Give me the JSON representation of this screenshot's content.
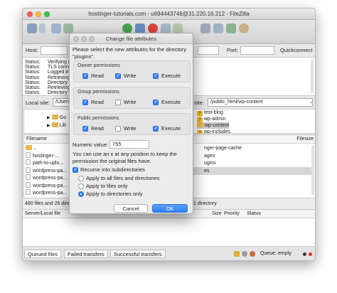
{
  "window": {
    "title": "hostinger-tutorials.com - u694443746@31.220.16.212 - FileZilla"
  },
  "quickconnect": {
    "host_label": "Host:",
    "port_label": "Port:",
    "button_label": "Quickconnect"
  },
  "log": {
    "lines": [
      {
        "label": "Status:",
        "text": "Verifying c"
      },
      {
        "label": "Status:",
        "text": "TLS connec"
      },
      {
        "label": "Status:",
        "text": "Logged in"
      },
      {
        "label": "Status:",
        "text": "Retrieving"
      },
      {
        "label": "Status:",
        "text": "Directory l"
      },
      {
        "label": "Status:",
        "text": "Retrieving"
      },
      {
        "label": "Status:",
        "text": "Directory l"
      }
    ]
  },
  "local": {
    "label": "Local site:",
    "path": "/Users",
    "tree": [
      "Go",
      "Lib"
    ],
    "filename_header": "Filename",
    "files": [
      "..",
      "hostinger-...",
      "path-to-uplo...",
      "wordpress-pa...",
      "wordpress-pa...",
      "wordpress-pa...",
      "wordpress-pa..."
    ],
    "status": "480 files and 26 dire"
  },
  "remote": {
    "label": "site:",
    "path": "/public_html/wp-content",
    "tree": [
      "test-blog",
      "wp-admin",
      "wp-content",
      "wp-includes"
    ],
    "filesize_header": "Filesize",
    "files": [
      "nger-page-cache",
      "ages",
      "ugins",
      "es",
      "",
      "",
      ""
    ],
    "status": "1 directory."
  },
  "queue": {
    "col_server": "Server/Local file",
    "col_size": "Size",
    "col_priority": "Priority",
    "col_status": "Status"
  },
  "tabs": [
    {
      "label": "Queued files",
      "active": true
    },
    {
      "label": "Failed transfers",
      "active": false
    },
    {
      "label": "Successful transfers",
      "active": false
    }
  ],
  "statusbar": {
    "queue": "Queue: empty"
  },
  "dialog": {
    "title": "Change file attributes",
    "intro": "Please select the new attributes for the directory \"plugins\".",
    "groups": [
      {
        "label": "Owner permissions",
        "read": true,
        "write": true,
        "execute": true
      },
      {
        "label": "Group permissions",
        "read": true,
        "write": false,
        "execute": true
      },
      {
        "label": "Public permissions",
        "read": true,
        "write": false,
        "execute": true
      }
    ],
    "read_label": "Read",
    "write_label": "Write",
    "execute_label": "Execute",
    "numeric_label": "Numeric value:",
    "numeric_value": "755",
    "help_text": "You can use an x at any position to keep the permission the original files have.",
    "recurse_label": "Recurse into subdirectories",
    "recurse_checked": true,
    "radio_options": [
      {
        "label": "Apply to all files and directories",
        "selected": false
      },
      {
        "label": "Apply to files only",
        "selected": false
      },
      {
        "label": "Apply to directories only",
        "selected": true
      }
    ],
    "cancel_label": "Cancel",
    "ok_label": "OK"
  },
  "colors": {
    "accent": "#3a82f7",
    "folder": "#e8b64a",
    "close": "#fc605c",
    "minimize": "#fdbc40",
    "zoom": "#34c84a"
  }
}
